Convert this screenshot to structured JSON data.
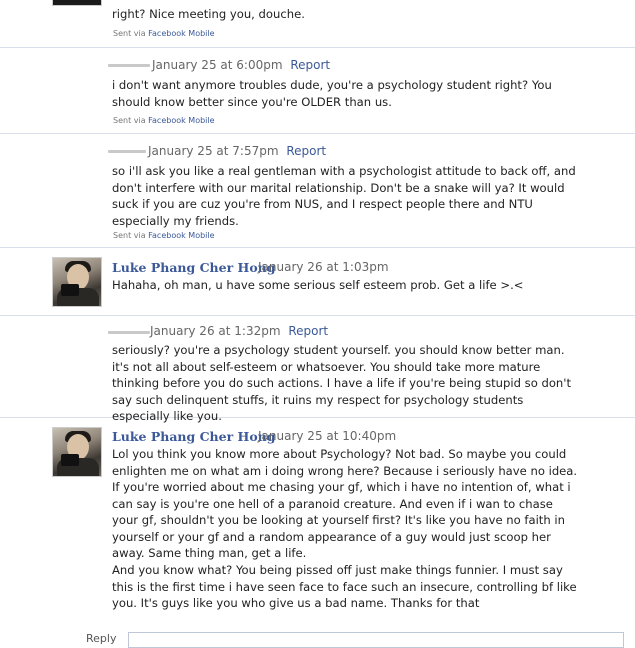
{
  "posts": [
    {
      "text": "right? Nice meeting you, douche.",
      "sent_via": "Sent via",
      "sent_link": "Facebook Mobile"
    },
    {
      "date": "January 25 at 6:00pm",
      "report": "Report",
      "text": "i don't want anymore troubles dude, you're a psychology student right? You should know better since you're OLDER than us.",
      "sent_via": "Sent via",
      "sent_link": "Facebook Mobile"
    },
    {
      "date": "January 25 at 7:57pm",
      "report": "Report",
      "text": "so i'll ask you like a real gentleman with a psychologist attitude to back off, and don't interfere with our marital relationship. Don't be a snake will ya? It would suck if you are cuz you're from NUS, and I respect people there and NTU especially my friends.",
      "sent_via": "Sent via",
      "sent_link": "Facebook Mobile"
    },
    {
      "author": "Luke Phang Cher Hong",
      "date": "January 26 at 1:03pm",
      "text": "Hahaha, oh man, u have some serious self esteem prob. Get a life >.<"
    },
    {
      "date": "January 26 at 1:32pm",
      "report": "Report",
      "text": "seriously? you're a psychology student yourself. you should know better man. it's not all about self-esteem or whatsoever. You should take more mature thinking before you do such actions. I have a life if you're being stupid so don't say such delinquent stuffs, it ruins my respect for psychology students especially like you."
    },
    {
      "author": "Luke Phang Cher Hong",
      "date": "January 25 at 10:40pm",
      "text": "Lol you think you know more about Psychology? Not bad. So maybe you could enlighten me on what am i doing wrong here? Because i seriously have no idea. If you're worried about me chasing your gf, which i have no intention of, what i can say is you're one hell of a paranoid creature. And even if i wan to chase your gf, shouldn't you be looking at yourself first? It's like you have no faith in yourself or your gf and a random appearance of a guy would just scoop her away. Same thing man, get a life.",
      "text2": "And you know what? You being pissed off just make things funnier. I must say this is the first time i have seen face to face such an insecure, controlling bf like you. It's guys like you who give us a bad name. Thanks for that"
    }
  ],
  "reply": {
    "label": "Reply"
  }
}
